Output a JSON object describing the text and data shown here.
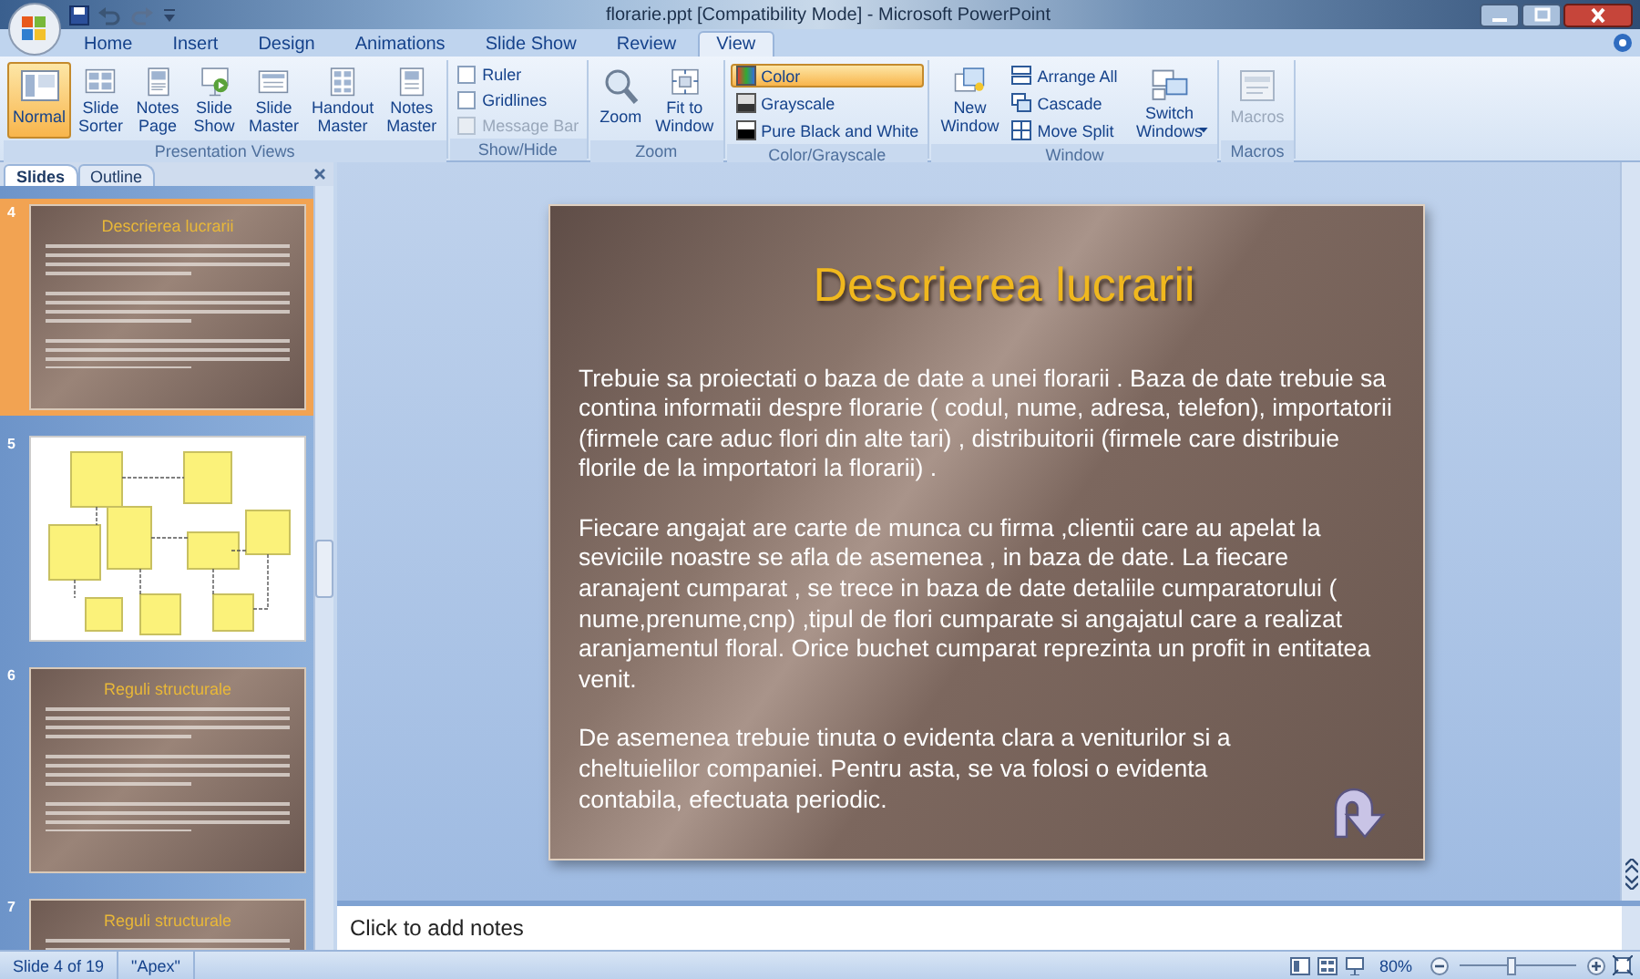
{
  "window": {
    "title": "florarie.ppt [Compatibility Mode] - Microsoft PowerPoint"
  },
  "ribbon_tabs": [
    {
      "label": "Home",
      "selected": false
    },
    {
      "label": "Insert",
      "selected": false
    },
    {
      "label": "Design",
      "selected": false
    },
    {
      "label": "Animations",
      "selected": false
    },
    {
      "label": "Slide Show",
      "selected": false
    },
    {
      "label": "Review",
      "selected": false
    },
    {
      "label": "View",
      "selected": true
    }
  ],
  "ribbon_groups": [
    {
      "label": "Presentation Views",
      "items": [
        {
          "kind": "large",
          "label": "Normal",
          "selected": true,
          "disabled": false
        },
        {
          "kind": "large",
          "label": "Slide\nSorter",
          "selected": false,
          "disabled": false
        },
        {
          "kind": "large",
          "label": "Notes\nPage",
          "selected": false,
          "disabled": false
        },
        {
          "kind": "large",
          "label": "Slide\nShow",
          "selected": false,
          "disabled": false
        },
        {
          "kind": "large",
          "label": "Slide\nMaster",
          "selected": false,
          "disabled": false
        },
        {
          "kind": "large",
          "label": "Handout\nMaster",
          "selected": false,
          "disabled": false
        },
        {
          "kind": "large",
          "label": "Notes\nMaster",
          "selected": false,
          "disabled": false
        }
      ]
    },
    {
      "label": "Show/Hide",
      "items": [
        {
          "kind": "check",
          "label": "Ruler",
          "checked": false,
          "disabled": false
        },
        {
          "kind": "check",
          "label": "Gridlines",
          "checked": false,
          "disabled": false
        },
        {
          "kind": "check",
          "label": "Message Bar",
          "checked": false,
          "disabled": true
        }
      ]
    },
    {
      "label": "Zoom",
      "items": [
        {
          "kind": "large",
          "label": "Zoom",
          "selected": false,
          "disabled": false
        },
        {
          "kind": "large",
          "label": "Fit to\nWindow",
          "selected": false,
          "disabled": false
        }
      ]
    },
    {
      "label": "Color/Grayscale",
      "items": [
        {
          "kind": "small",
          "label": "Color",
          "selected": true
        },
        {
          "kind": "small",
          "label": "Grayscale",
          "selected": false
        },
        {
          "kind": "small",
          "label": "Pure Black and White",
          "selected": false
        }
      ]
    },
    {
      "label": "Window",
      "items": [
        {
          "kind": "large",
          "label": "New\nWindow",
          "selected": false,
          "disabled": false
        },
        {
          "kind": "small",
          "label": "Arrange All",
          "selected": false
        },
        {
          "kind": "small",
          "label": "Cascade",
          "selected": false
        },
        {
          "kind": "small",
          "label": "Move Split",
          "selected": false
        },
        {
          "kind": "large",
          "label": "Switch\nWindows",
          "selected": false,
          "disabled": false,
          "dropdown": true
        }
      ]
    },
    {
      "label": "Macros",
      "items": [
        {
          "kind": "large",
          "label": "Macros",
          "selected": false,
          "disabled": true
        }
      ]
    }
  ],
  "pane_tabs": [
    {
      "label": "Slides",
      "selected": true
    },
    {
      "label": "Outline",
      "selected": false
    }
  ],
  "thumbnails": [
    {
      "number": "4",
      "kind": "text",
      "title": "Descrierea lucrarii",
      "selected": true
    },
    {
      "number": "5",
      "kind": "diagram",
      "selected": false
    },
    {
      "number": "6",
      "kind": "text",
      "title": "Reguli structurale",
      "selected": false
    },
    {
      "number": "7",
      "kind": "text",
      "title": "Reguli structurale",
      "selected": false
    }
  ],
  "slide": {
    "title": "Descrierea lucrarii",
    "paragraphs": [
      "Trebuie sa proiectati o baza de date a unei florarii . Baza de date trebuie sa contina informatii despre florarie ( codul, nume, adresa, telefon), importatorii (firmele care aduc flori din alte tari) , distribuitorii (firmele care distribuie florile de la importatori la florarii) .",
      "Fiecare angajat are carte de munca cu firma ,clientii care au apelat la seviciile noastre se afla de asemenea , in baza de date. La fiecare aranajent cumparat , se trece in baza de date detaliile cumparatorului ( nume,prenume,cnp) ,tipul de flori cumparate si angajatul care a realizat aranjamentul floral. Orice buchet cumparat reprezinta un profit in entitatea venit.",
      "De asemenea trebuie tinuta o evidenta clara a veniturilor si a cheltuielilor companiei. Pentru asta, se va folosi o evidenta contabila, efectuata periodic."
    ]
  },
  "notes": {
    "placeholder": "Click to add notes"
  },
  "status_bar": {
    "slide_position": "Slide 4 of 19",
    "theme": "\"Apex\"",
    "zoom": "80%",
    "zoom_slider": {
      "level": 0.45
    }
  }
}
